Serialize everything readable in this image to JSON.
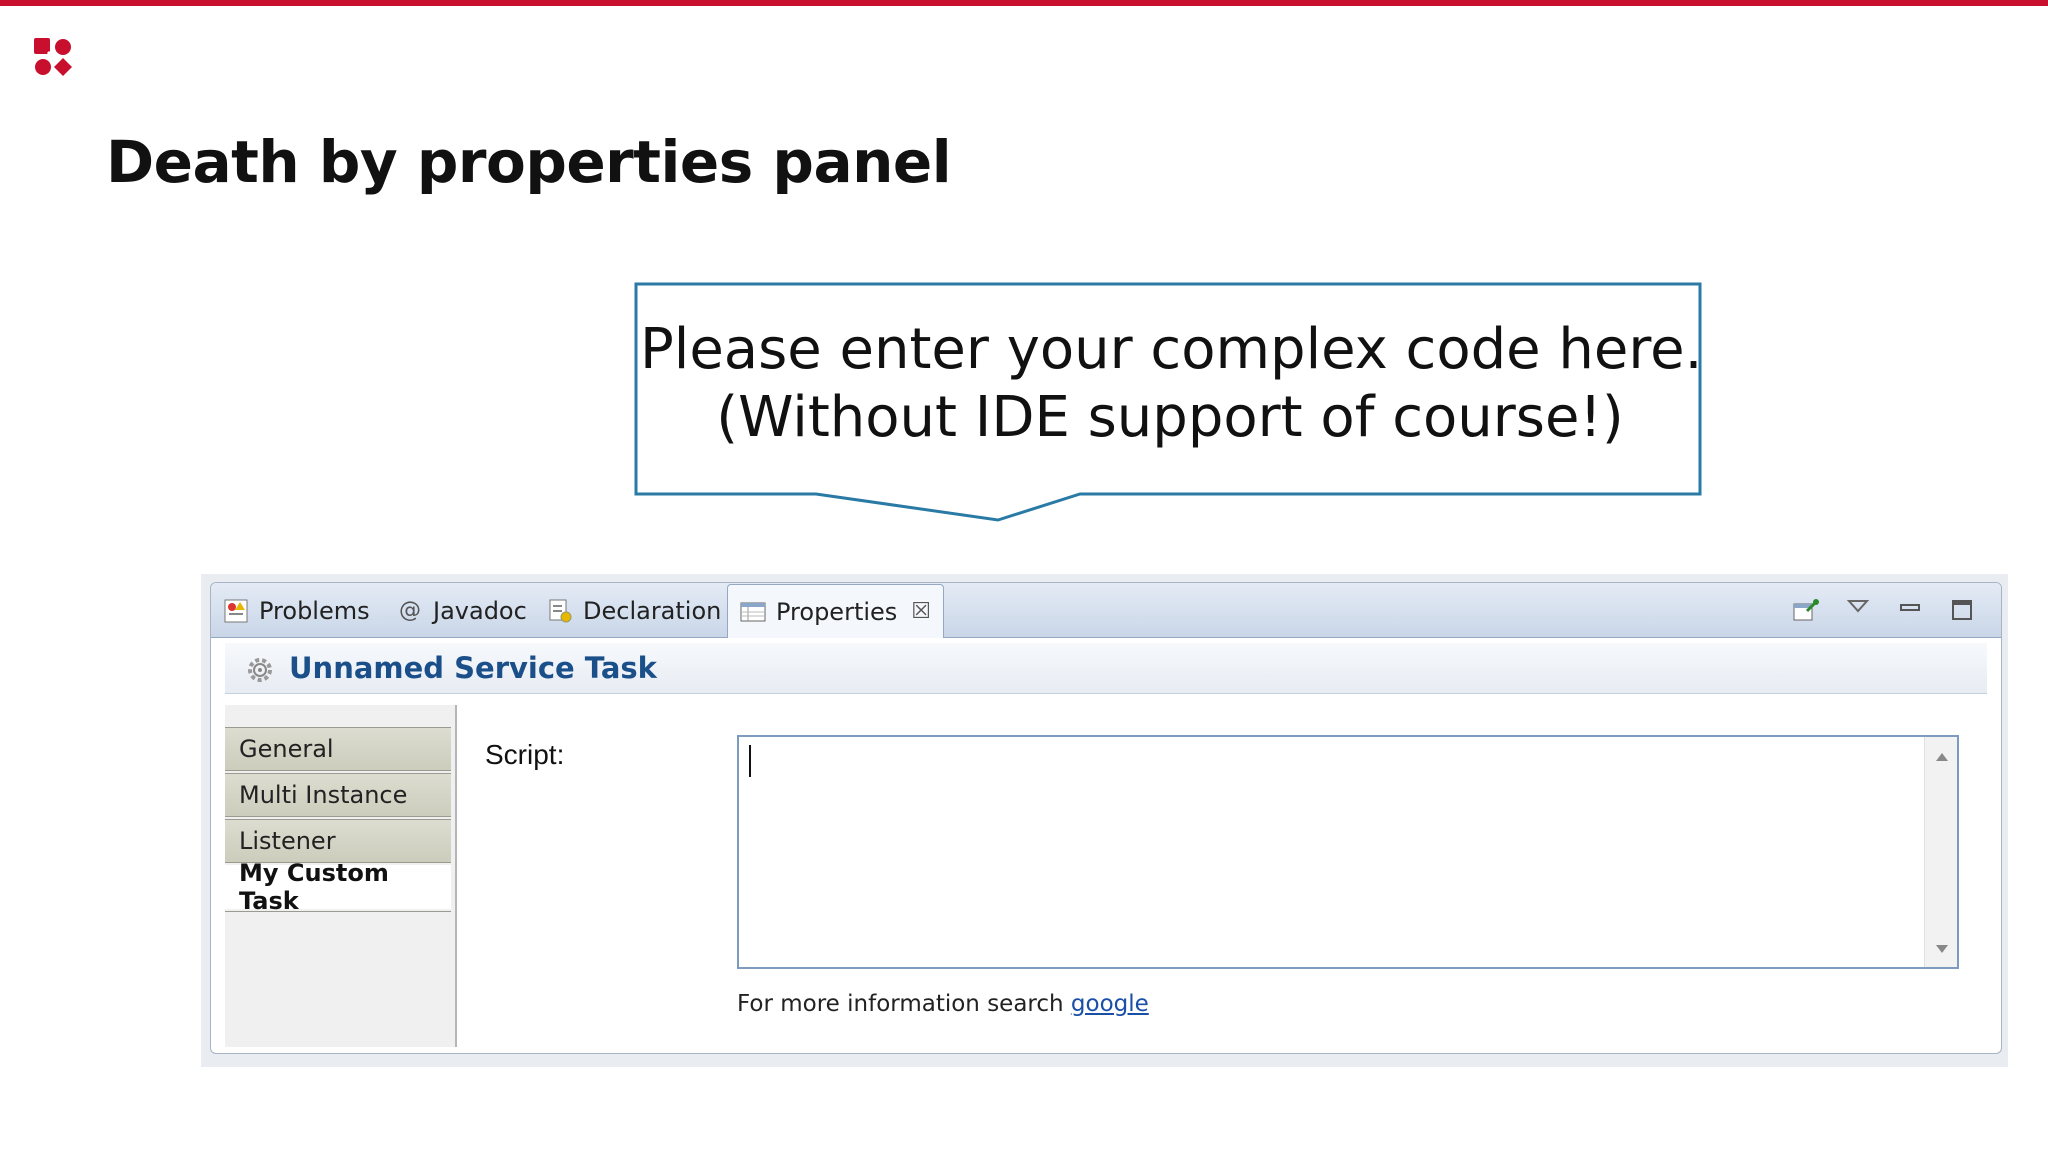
{
  "slide": {
    "title": "Death by properties panel",
    "brand_color": "#c8102e"
  },
  "callout": {
    "line1": "Please enter your complex code here.",
    "line2": "(Without IDE support of course!)",
    "border_color": "#2a7aa6"
  },
  "ide": {
    "tabs": [
      {
        "label": "Problems",
        "icon": "problems-icon"
      },
      {
        "label": "Javadoc",
        "icon": "at-icon"
      },
      {
        "label": "Declaration",
        "icon": "declaration-icon"
      },
      {
        "label": "Properties",
        "icon": "properties-icon",
        "active": true
      }
    ],
    "close_glyph": "☒",
    "toolbar_icons": [
      "pin-icon",
      "view-menu-icon",
      "minimize-icon",
      "maximize-icon"
    ],
    "header_title": "Unnamed Service Task",
    "sidebar_items": [
      "General",
      "Multi Instance",
      "Listener",
      "My Custom Task"
    ],
    "selected_item": "My Custom Task",
    "script_label": "Script:",
    "script_value": "",
    "info_text": "For more information search ",
    "info_link": "google",
    "accent_color": "#1a4f8a"
  }
}
